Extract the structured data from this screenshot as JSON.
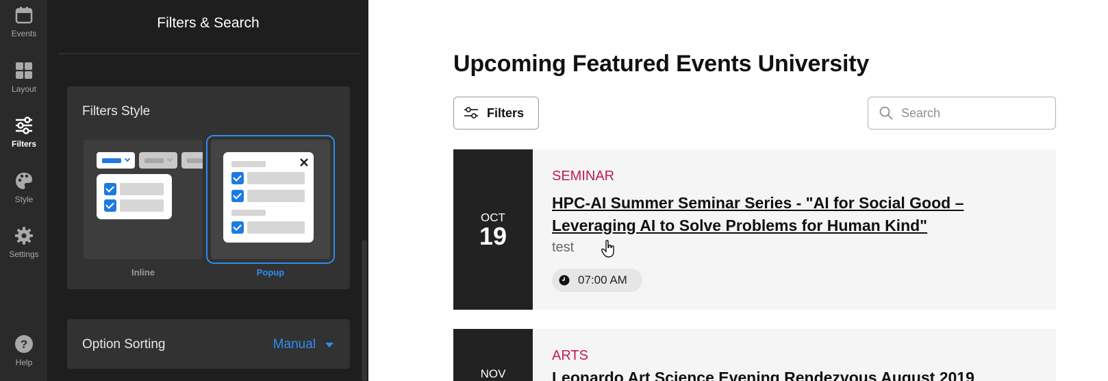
{
  "rail": {
    "events": "Events",
    "layout": "Layout",
    "filters": "Filters",
    "style": "Style",
    "settings": "Settings",
    "help": "Help"
  },
  "panel": {
    "title": "Filters & Search",
    "filters_style": {
      "title": "Filters Style",
      "options": [
        "Inline",
        "Popup"
      ],
      "selected": "Popup"
    },
    "option_sorting": {
      "label": "Option Sorting",
      "value": "Manual"
    }
  },
  "main": {
    "title": "Upcoming Featured Events University",
    "filters_button": "Filters",
    "search_placeholder": "Search",
    "events": [
      {
        "month": "OCT",
        "day": "19",
        "category": "SEMINAR",
        "title": "HPC-AI Summer Seminar Series - \"AI for Social Good – Leveraging AI to Solve Problems for Human Kind\"",
        "subtitle": "test",
        "time": "07:00 AM"
      },
      {
        "month": "NOV",
        "category": "ARTS",
        "title": "Leonardo Art Science Evening Rendezvous August 2019"
      }
    ]
  },
  "colors": {
    "accent": "#2e8ef0",
    "category": "#c2185b",
    "panel_bg": "#1e1e1e",
    "rail_bg": "#2a2a2a"
  }
}
